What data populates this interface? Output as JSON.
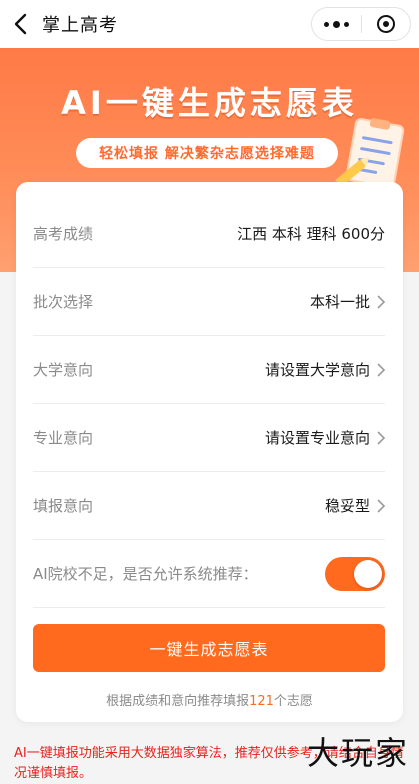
{
  "nav": {
    "title": "掌上高考"
  },
  "banner": {
    "title": "AI一键生成志愿表",
    "subtitle": "轻松填报  解决繁杂志愿选择难题"
  },
  "form": {
    "rows": [
      {
        "label": "高考成绩",
        "value": "江西 本科 理科 600分",
        "has_arrow": false
      },
      {
        "label": "批次选择",
        "value": "本科一批",
        "has_arrow": true
      },
      {
        "label": "大学意向",
        "value": "请设置大学意向",
        "has_arrow": true
      },
      {
        "label": "专业意向",
        "value": "请设置专业意向",
        "has_arrow": true
      },
      {
        "label": "填报意向",
        "value": "稳妥型",
        "has_arrow": true
      }
    ],
    "toggle": {
      "label": "AI院校不足，是否允许系统推荐：",
      "on": true
    }
  },
  "cta": {
    "label": "一键生成志愿表"
  },
  "hint": {
    "prefix": "根据成绩和意向推荐填报",
    "count": "121",
    "suffix": "个志愿"
  },
  "disclaimer": "AI一键填报功能采用大数据独家算法，推荐仅供参考，请结合自身情况谨慎填报。",
  "watermark": "大玩家",
  "colors": {
    "accent": "#ff6a1e",
    "banner": "#ff7a46",
    "warning": "#e8231e"
  }
}
